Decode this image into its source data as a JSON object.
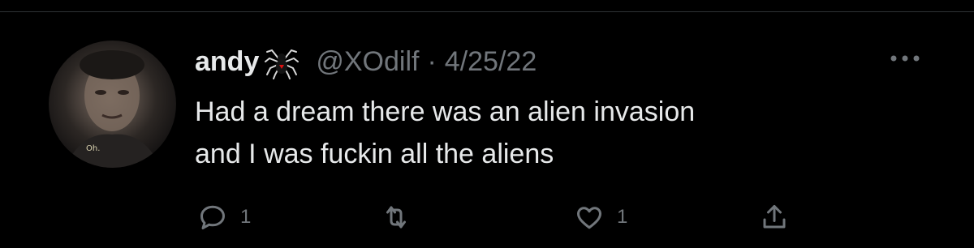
{
  "tweet": {
    "display_name": "andy",
    "name_emoji_icon": "spider-icon",
    "handle": "@XOdilf",
    "separator": "·",
    "timestamp": "4/25/22",
    "text_lines": [
      "Had a dream there was an alien invasion",
      "and I was fuckin all the aliens"
    ],
    "avatar_caption": "Oh.",
    "replies": "1",
    "retweets": "",
    "likes": "1"
  },
  "colors": {
    "background": "#000000",
    "primary_text": "#e7e9ea",
    "secondary_text": "#71767b",
    "divider": "#2f3336"
  },
  "icons": {
    "reply": "reply-icon",
    "retweet": "retweet-icon",
    "like": "heart-icon",
    "share": "share-icon",
    "more": "more-icon"
  }
}
